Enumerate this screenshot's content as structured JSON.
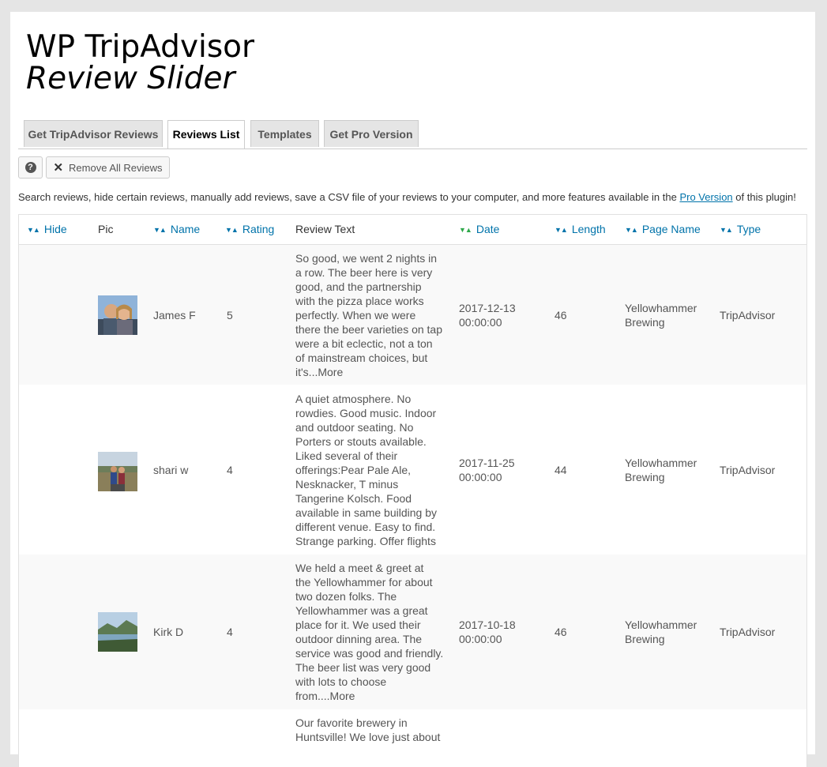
{
  "title": {
    "line1": "WP TripAdvisor",
    "line2": "Review Slider"
  },
  "tabs": [
    {
      "label": "Get TripAdvisor Reviews",
      "active": false
    },
    {
      "label": "Reviews List",
      "active": true
    },
    {
      "label": "Templates",
      "active": false
    },
    {
      "label": "Get Pro Version",
      "active": false
    }
  ],
  "toolbar": {
    "help_icon": "?",
    "remove_label": "Remove All Reviews"
  },
  "info": {
    "before": "Search reviews, hide certain reviews, manually add reviews, save a CSV file of your reviews to your computer, and more features available in the ",
    "link": "Pro Version",
    "after": " of this plugin!"
  },
  "columns": {
    "hide": "Hide",
    "pic": "Pic",
    "name": "Name",
    "rating": "Rating",
    "review_text": "Review Text",
    "date": "Date",
    "length": "Length",
    "page_name": "Page Name",
    "type": "Type"
  },
  "sort_arrows": {
    "down": "▼",
    "up": "▲"
  },
  "colors": {
    "link": "#0073aa",
    "sort_active": "#2ea84a",
    "tab_bg": "#e5e5e5"
  },
  "rows": [
    {
      "name": "James F",
      "rating": "5",
      "review_lines": [
        "So good, we went 2 nights in",
        "a row. The beer here is very",
        "good, and the partnership",
        "with the pizza place works",
        "perfectly. When we were",
        "there the beer varieties on tap",
        "were a bit eclectic, not a ton",
        "of mainstream choices, but",
        "it's...More"
      ],
      "date_line1": "2017-12-13",
      "date_line2": "00:00:00",
      "length": "46",
      "page_line1": "Yellowhammer",
      "page_line2": "Brewing",
      "type": "TripAdvisor"
    },
    {
      "name": "shari w",
      "rating": "4",
      "review_lines": [
        "A quiet atmosphere. No",
        "rowdies. Good music. Indoor",
        "and outdoor seating. No",
        "Porters or stouts available.",
        "Liked several of their",
        "offerings:Pear Pale Ale,",
        "Nesknacker, T minus",
        "Tangerine Kolsch. Food",
        "available in same building by",
        "different venue. Easy to find.",
        "Strange parking. Offer flights"
      ],
      "date_line1": "2017-11-25",
      "date_line2": "00:00:00",
      "length": "44",
      "page_line1": "Yellowhammer",
      "page_line2": "Brewing",
      "type": "TripAdvisor"
    },
    {
      "name": "Kirk D",
      "rating": "4",
      "review_lines": [
        "We held a meet & greet at",
        "the Yellowhammer for about",
        "two dozen folks. The",
        "Yellowhammer was a great",
        "place for it. We used their",
        "outdoor dinning area. The",
        "service was good and friendly.",
        "The beer list was very good",
        "with lots to choose",
        "from....More"
      ],
      "date_line1": "2017-10-18",
      "date_line2": "00:00:00",
      "length": "46",
      "page_line1": "Yellowhammer",
      "page_line2": "Brewing",
      "type": "TripAdvisor"
    },
    {
      "review_lines": [
        "Our favorite brewery in",
        "Huntsville! We love just about"
      ]
    }
  ]
}
